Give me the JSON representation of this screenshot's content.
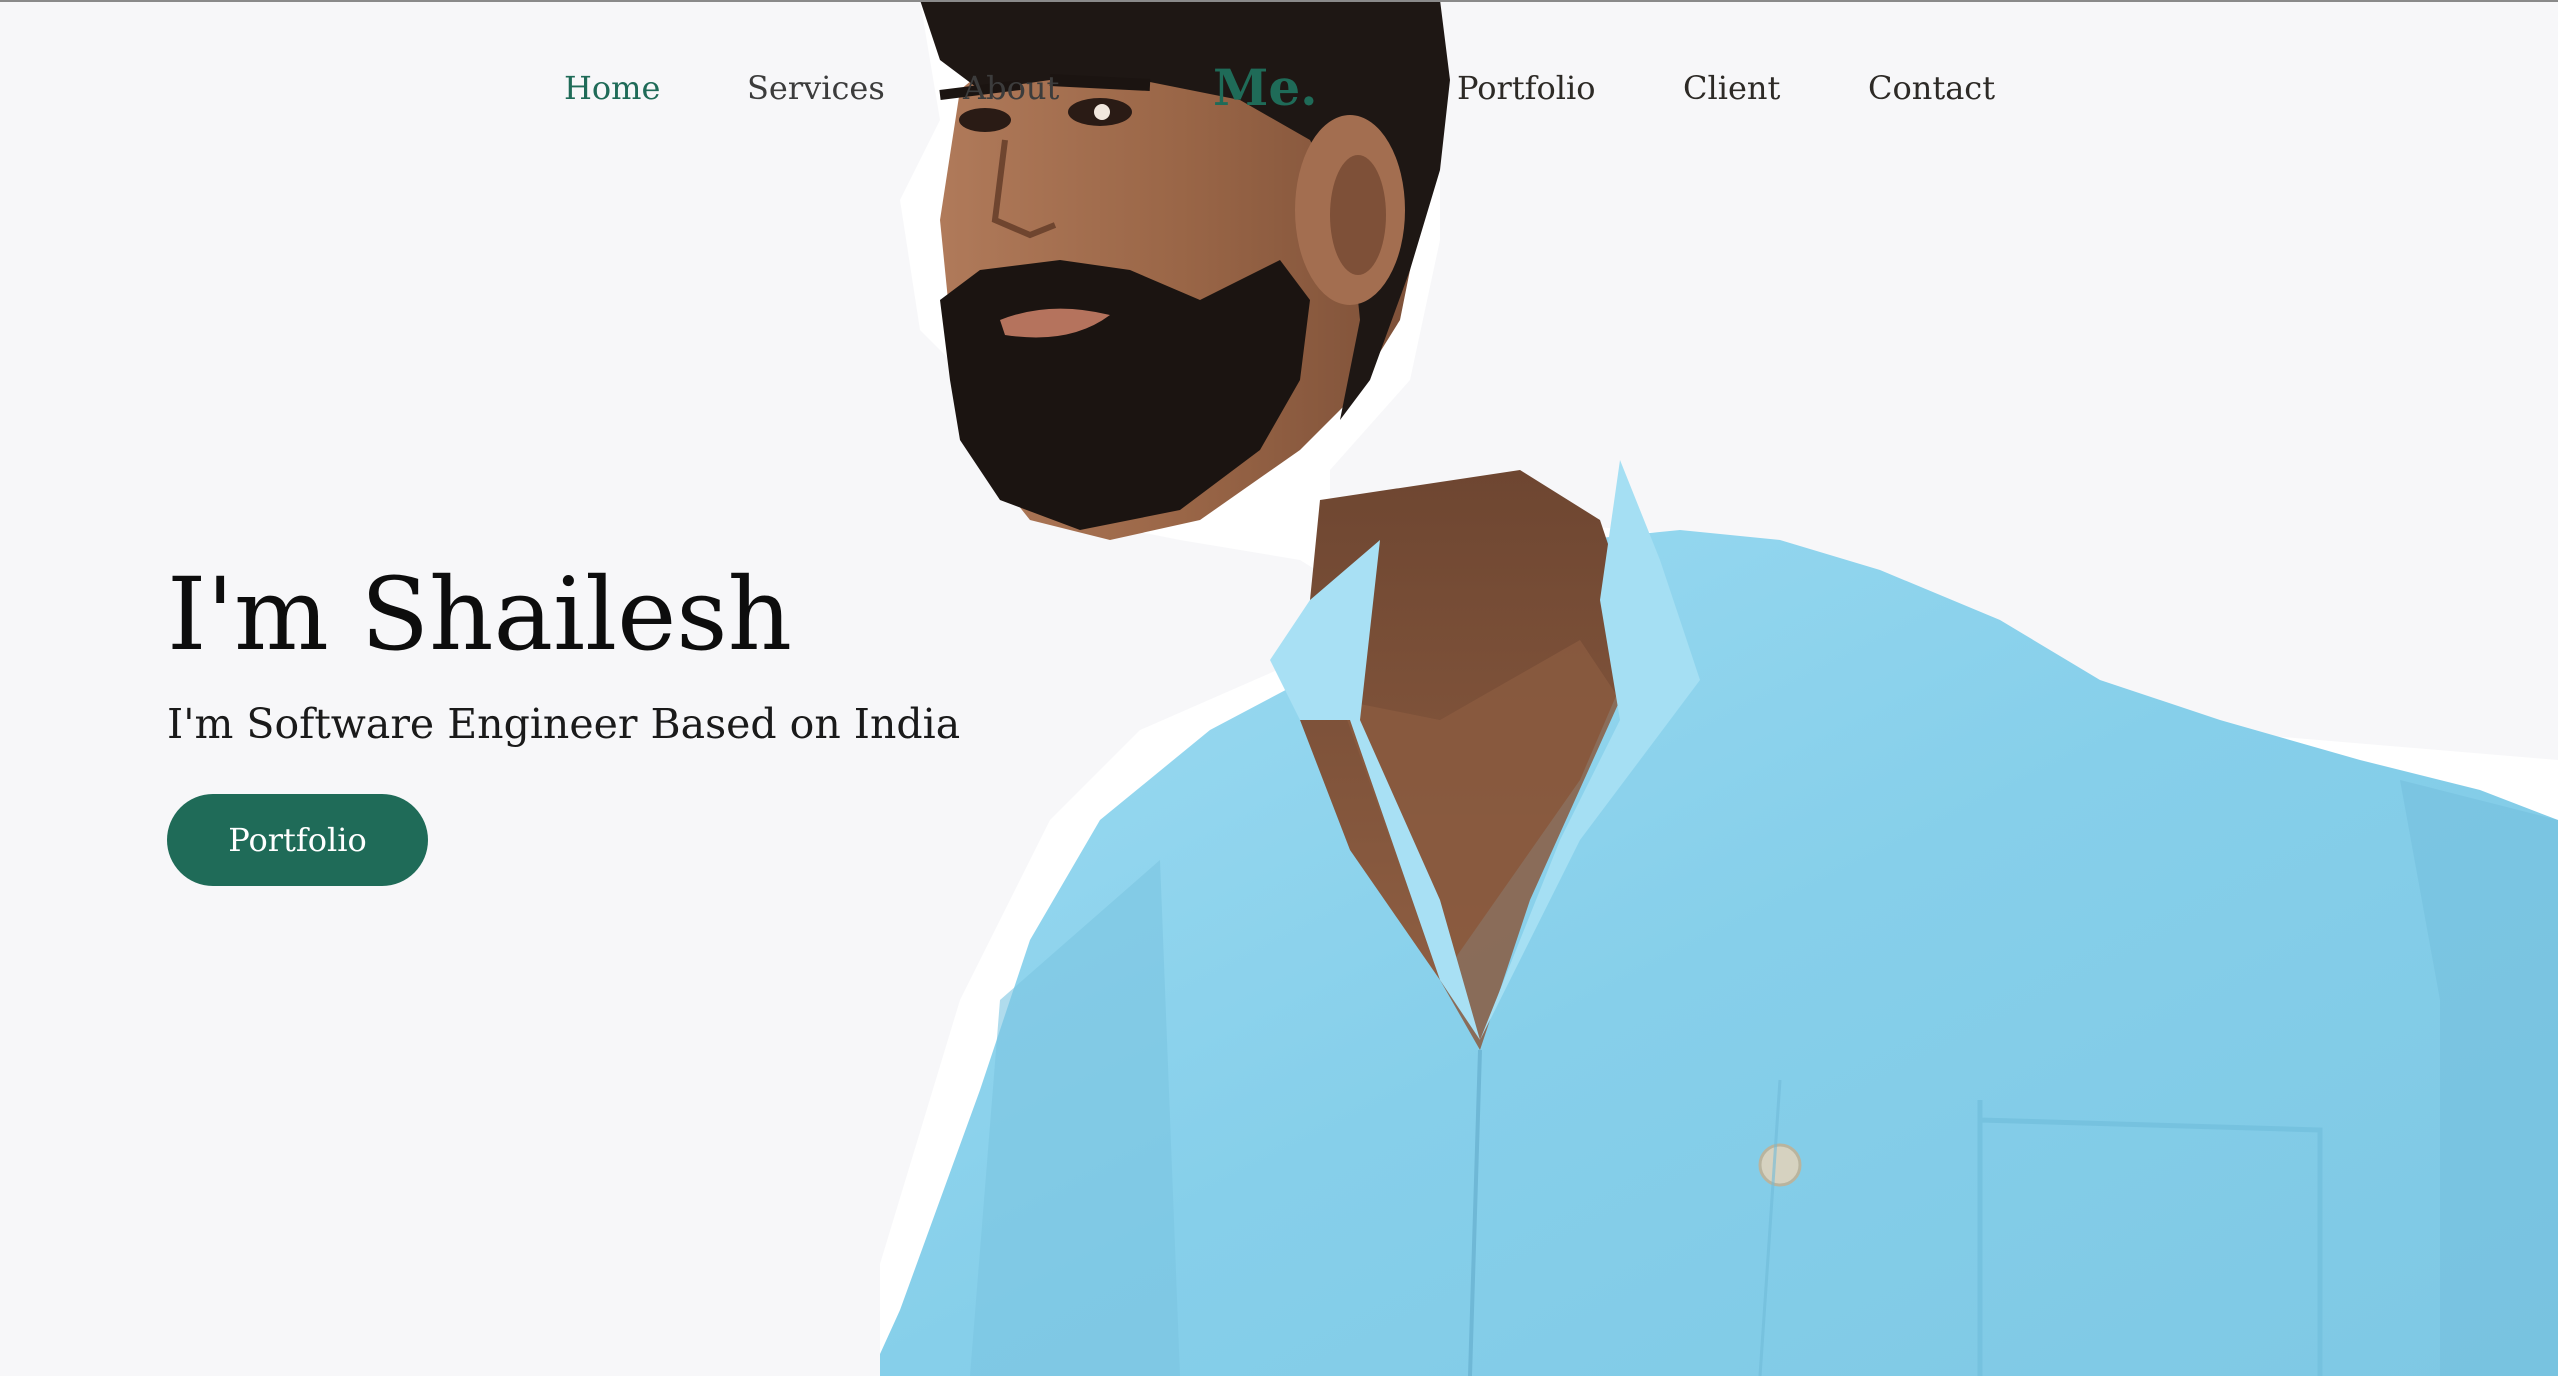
{
  "nav": {
    "home": "Home",
    "services": "Services",
    "about": "About",
    "brand": "Me.",
    "portfolio": "Portfolio",
    "client": "Client",
    "contact": "Contact"
  },
  "hero": {
    "title": "I'm Shailesh",
    "subtitle": "I'm Software Engineer Based on India",
    "button_label": "Portfolio"
  },
  "colors": {
    "accent": "#1f6b58",
    "background": "#f7f7f9",
    "shirt": "#8fd3ec"
  }
}
